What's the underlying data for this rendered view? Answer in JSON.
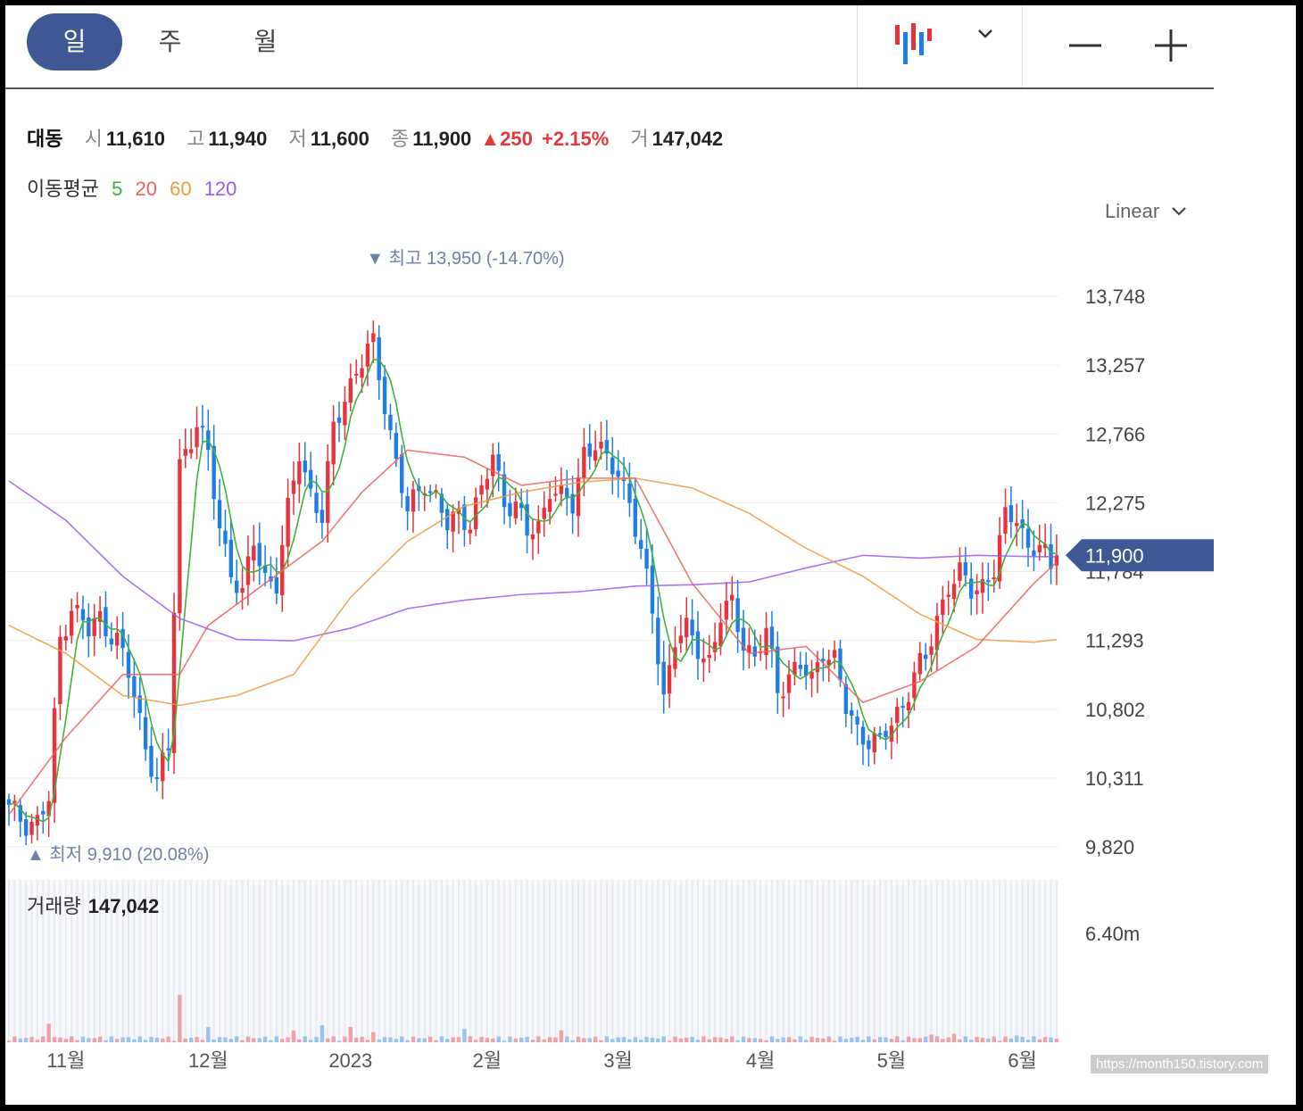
{
  "tabs": [
    {
      "label": "일",
      "active": true
    },
    {
      "label": "주",
      "active": false
    },
    {
      "label": "월",
      "active": false
    }
  ],
  "toolbar": {
    "chart_type_icon": "candlestick-icon",
    "dropdown_icon": "chevron-down-icon",
    "zoom_out_icon": "minus-icon",
    "zoom_in_icon": "plus-icon"
  },
  "info": {
    "name": "대동",
    "open_label": "시",
    "open": "11,610",
    "high_label": "고",
    "high": "11,940",
    "low_label": "저",
    "low": "11,600",
    "close_label": "종",
    "close": "11,900",
    "change": "▲250",
    "change_pct": "+2.15%",
    "volume_label": "거",
    "volume": "147,042"
  },
  "ma": {
    "label": "이동평균",
    "periods": [
      {
        "label": "5",
        "color": "#3cb43c"
      },
      {
        "label": "20",
        "color": "#f06060"
      },
      {
        "label": "60",
        "color": "#f09a40"
      },
      {
        "label": "120",
        "color": "#9a5cf0"
      }
    ]
  },
  "scale_select": {
    "label": "Linear"
  },
  "colors": {
    "up": "#e8323c",
    "down": "#1e7ee6",
    "badge": "#3d5894",
    "annotation": "#6f7fa8"
  },
  "chart_data": {
    "type": "candlestick",
    "y_ticks": [
      "13,748",
      "13,257",
      "12,766",
      "12,275",
      "11,784",
      "11,293",
      "10,802",
      "10,311",
      "9,820"
    ],
    "y_tick_values": [
      13748,
      13257,
      12766,
      12275,
      11784,
      11293,
      10802,
      10311,
      9820
    ],
    "x_ticks": [
      "11월",
      "12월",
      "2023",
      "2월",
      "3월",
      "4월",
      "5월",
      "6월"
    ],
    "x_tick_index": [
      10,
      35,
      60,
      84,
      107,
      132,
      155,
      178
    ],
    "current_price": "11,900",
    "current_value": 11900,
    "high_annotation": {
      "label": "최고",
      "value": "13,950",
      "pct": "(-14.70%)",
      "index": 64
    },
    "low_annotation": {
      "label": "최저",
      "value": "9,910",
      "pct": "(20.08%)",
      "index": 5
    },
    "close_anchors": [
      [
        0,
        10080
      ],
      [
        3,
        10000
      ],
      [
        5,
        10000
      ],
      [
        7,
        10150
      ],
      [
        9,
        11300
      ],
      [
        11,
        11550
      ],
      [
        14,
        11350
      ],
      [
        16,
        11450
      ],
      [
        19,
        11300
      ],
      [
        21,
        11050
      ],
      [
        24,
        10550
      ],
      [
        26,
        10300
      ],
      [
        28,
        10500
      ],
      [
        30,
        12550
      ],
      [
        33,
        12850
      ],
      [
        35,
        12600
      ],
      [
        37,
        12100
      ],
      [
        39,
        11800
      ],
      [
        41,
        11600
      ],
      [
        43,
        12000
      ],
      [
        45,
        11750
      ],
      [
        47,
        11700
      ],
      [
        49,
        12200
      ],
      [
        51,
        12650
      ],
      [
        53,
        12350
      ],
      [
        55,
        12150
      ],
      [
        57,
        12800
      ],
      [
        59,
        13050
      ],
      [
        61,
        13200
      ],
      [
        63,
        13350
      ],
      [
        64,
        13400
      ],
      [
        66,
        13000
      ],
      [
        68,
        12550
      ],
      [
        70,
        12200
      ],
      [
        73,
        12450
      ],
      [
        75,
        12300
      ],
      [
        77,
        12100
      ],
      [
        79,
        12200
      ],
      [
        81,
        12150
      ],
      [
        83,
        12350
      ],
      [
        85,
        12600
      ],
      [
        87,
        12300
      ],
      [
        89,
        12250
      ],
      [
        91,
        12050
      ],
      [
        93,
        12100
      ],
      [
        95,
        12400
      ],
      [
        97,
        12300
      ],
      [
        99,
        12250
      ],
      [
        101,
        12650
      ],
      [
        103,
        12700
      ],
      [
        105,
        12550
      ],
      [
        107,
        12500
      ],
      [
        109,
        12300
      ],
      [
        111,
        11900
      ],
      [
        113,
        11500
      ],
      [
        115,
        10900
      ],
      [
        117,
        11300
      ],
      [
        119,
        11350
      ],
      [
        121,
        11250
      ],
      [
        123,
        11150
      ],
      [
        125,
        11450
      ],
      [
        127,
        11550
      ],
      [
        129,
        11300
      ],
      [
        131,
        11150
      ],
      [
        133,
        11350
      ],
      [
        135,
        10950
      ],
      [
        137,
        11050
      ],
      [
        139,
        11100
      ],
      [
        141,
        11000
      ],
      [
        143,
        11250
      ],
      [
        145,
        11150
      ],
      [
        147,
        10800
      ],
      [
        149,
        10650
      ],
      [
        151,
        10600
      ],
      [
        153,
        10550
      ],
      [
        155,
        10700
      ],
      [
        157,
        10850
      ],
      [
        159,
        11050
      ],
      [
        161,
        11150
      ],
      [
        163,
        11450
      ],
      [
        165,
        11700
      ],
      [
        167,
        11750
      ],
      [
        169,
        11650
      ],
      [
        171,
        11700
      ],
      [
        173,
        11800
      ],
      [
        175,
        12150
      ],
      [
        177,
        12200
      ],
      [
        179,
        11950
      ],
      [
        181,
        11950
      ],
      [
        183,
        11800
      ],
      [
        184,
        11900
      ]
    ],
    "ma_paths": [
      {
        "period": "120",
        "points": [
          [
            0,
            12430
          ],
          [
            10,
            12150
          ],
          [
            20,
            11750
          ],
          [
            30,
            11450
          ],
          [
            40,
            11300
          ],
          [
            50,
            11290
          ],
          [
            60,
            11380
          ],
          [
            70,
            11520
          ],
          [
            80,
            11580
          ],
          [
            90,
            11620
          ],
          [
            100,
            11640
          ],
          [
            110,
            11680
          ],
          [
            120,
            11690
          ],
          [
            130,
            11710
          ],
          [
            140,
            11810
          ],
          [
            150,
            11900
          ],
          [
            160,
            11880
          ],
          [
            170,
            11900
          ],
          [
            180,
            11890
          ],
          [
            184,
            11890
          ]
        ]
      },
      {
        "period": "60",
        "points": [
          [
            0,
            11400
          ],
          [
            10,
            11200
          ],
          [
            20,
            10900
          ],
          [
            30,
            10830
          ],
          [
            40,
            10900
          ],
          [
            50,
            11050
          ],
          [
            60,
            11600
          ],
          [
            70,
            12000
          ],
          [
            80,
            12250
          ],
          [
            90,
            12350
          ],
          [
            100,
            12420
          ],
          [
            110,
            12450
          ],
          [
            120,
            12380
          ],
          [
            130,
            12200
          ],
          [
            140,
            11950
          ],
          [
            150,
            11750
          ],
          [
            160,
            11480
          ],
          [
            170,
            11300
          ],
          [
            180,
            11280
          ],
          [
            184,
            11300
          ]
        ]
      },
      {
        "period": "20",
        "points": [
          [
            0,
            10050
          ],
          [
            10,
            10600
          ],
          [
            20,
            11050
          ],
          [
            30,
            11050
          ],
          [
            35,
            11400
          ],
          [
            45,
            11700
          ],
          [
            55,
            12000
          ],
          [
            62,
            12350
          ],
          [
            70,
            12650
          ],
          [
            80,
            12600
          ],
          [
            90,
            12400
          ],
          [
            100,
            12450
          ],
          [
            110,
            12450
          ],
          [
            120,
            11700
          ],
          [
            130,
            11200
          ],
          [
            140,
            11250
          ],
          [
            150,
            10850
          ],
          [
            160,
            11000
          ],
          [
            170,
            11250
          ],
          [
            180,
            11700
          ],
          [
            184,
            11850
          ]
        ]
      }
    ],
    "volume": {
      "title": "거래량",
      "value": "147,042",
      "y_tick": "6.40m",
      "y_tick_value": 6400000,
      "spikes": [
        [
          7,
          1.1
        ],
        [
          30,
          2.8
        ],
        [
          35,
          0.9
        ],
        [
          50,
          0.7
        ],
        [
          55,
          1.0
        ],
        [
          60,
          0.9
        ],
        [
          64,
          0.6
        ],
        [
          80,
          0.8
        ],
        [
          97,
          0.7
        ],
        [
          110,
          0.3
        ],
        [
          132,
          0.2
        ],
        [
          147,
          0.2
        ],
        [
          162,
          0.45
        ],
        [
          166,
          0.5
        ],
        [
          177,
          0.4
        ]
      ]
    }
  },
  "watermark": "https://month150.tistory.com"
}
